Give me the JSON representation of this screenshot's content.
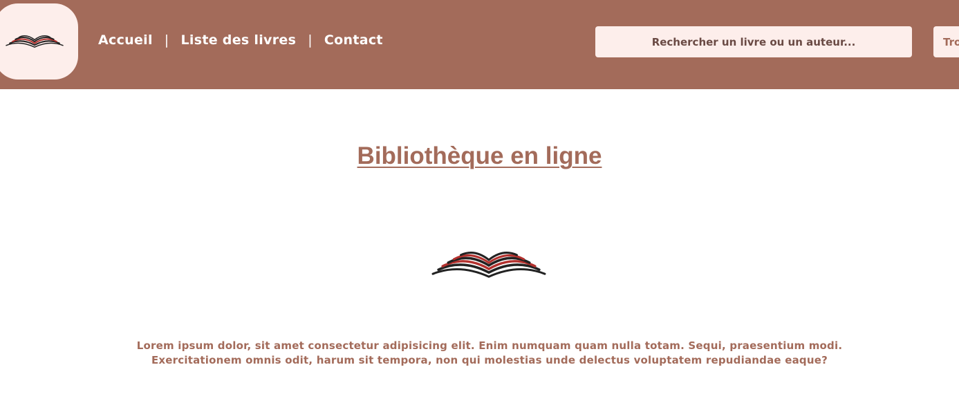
{
  "header": {
    "logo_icon": "open-book-icon",
    "nav": {
      "home": "Accueil",
      "separator": "|",
      "books": "Liste des livres",
      "contact": "Contact"
    },
    "search": {
      "placeholder": "Rechercher un livre ou un auteur...",
      "button_label": "Trouver"
    }
  },
  "main": {
    "title": "Bibliothèque en ligne",
    "hero_icon": "open-book-icon",
    "description_line1": "Lorem ipsum dolor, sit amet consectetur adipisicing elit. Enim numquam quam nulla totam. Sequi, praesentium modi.",
    "description_line2": "Exercitationem omnis odit, harum sit tempora, non qui molestias unde delectus voluptatem repudiandae eaque?"
  },
  "colors": {
    "header_bg": "#a36b5a",
    "pill_bg": "#fdeeeb",
    "accent_text": "#a36b5a",
    "book_dark": "#222222",
    "book_red": "#b3312e"
  }
}
